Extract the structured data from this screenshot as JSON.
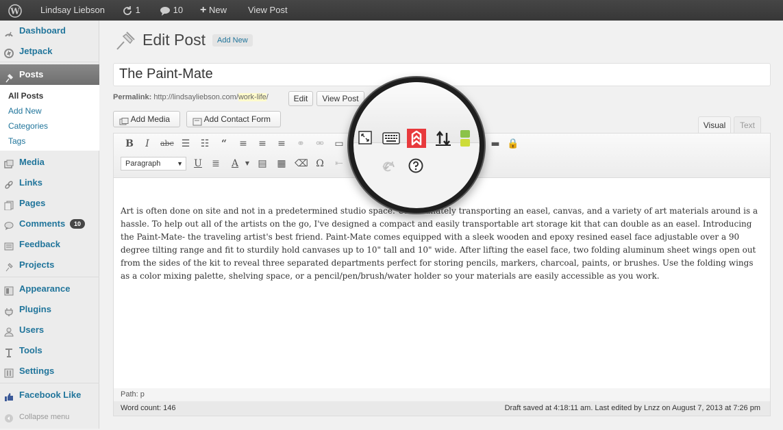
{
  "admin_bar": {
    "user": "Lindsay Liebson",
    "updates_count": "1",
    "comments_count": "10",
    "new_label": "New",
    "view_post_label": "View Post"
  },
  "sidebar": {
    "items": [
      {
        "label": "Dashboard",
        "icon": "dashboard-icon"
      },
      {
        "label": "Jetpack",
        "icon": "jetpack-icon"
      },
      {
        "label": "Posts",
        "icon": "pin-icon"
      },
      {
        "label": "Media",
        "icon": "media-icon"
      },
      {
        "label": "Links",
        "icon": "link-icon"
      },
      {
        "label": "Pages",
        "icon": "pages-icon"
      },
      {
        "label": "Comments",
        "icon": "comment-icon",
        "badge": "10"
      },
      {
        "label": "Feedback",
        "icon": "feedback-icon"
      },
      {
        "label": "Projects",
        "icon": "projects-icon"
      },
      {
        "label": "Appearance",
        "icon": "appearance-icon"
      },
      {
        "label": "Plugins",
        "icon": "plugin-icon"
      },
      {
        "label": "Users",
        "icon": "users-icon"
      },
      {
        "label": "Tools",
        "icon": "tools-icon"
      },
      {
        "label": "Settings",
        "icon": "settings-icon"
      },
      {
        "label": "Facebook Like",
        "icon": "thumbs-up-icon"
      }
    ],
    "posts_submenu": [
      "All Posts",
      "Add New",
      "Categories",
      "Tags"
    ],
    "collapse_label": "Collapse menu"
  },
  "page": {
    "heading": "Edit Post",
    "add_new_label": "Add New"
  },
  "post": {
    "title": "The Paint-Mate",
    "permalink_label": "Permalink:",
    "permalink_base": "http://lindsayliebson.com/",
    "permalink_slug": "work-life",
    "permalink_trailing": "/",
    "edit_label": "Edit",
    "view_post_label": "View Post"
  },
  "media_buttons": {
    "add_media": "Add Media",
    "add_contact_form": "Add Contact Form"
  },
  "editor_tabs": {
    "visual": "Visual",
    "text": "Text"
  },
  "toolbar": {
    "format_select_value": "Paragraph"
  },
  "content": {
    "body": "Art is often done on site and not in a predetermined studio space. Unfortunately transporting an easel, canvas, and a variety of art materials around is a hassle. To help out all of the artists on the go, I've designed a compact and easily transportable art storage kit that can double as an easel. Introducing the Paint-Mate- the traveling artist's best friend. Paint-Mate comes equipped with a sleek wooden and epoxy resined easel face adjustable over a 90 degree tilting range and fit to sturdily hold canvases up to 10\" tall and 10\" wide. After lifting the easel face, two folding aluminum sheet wings open out from the sides of the kit to reveal three separated departments perfect for storing pencils, markers, charcoal, paints, or brushes. Use the folding wings as a color mixing palette, shelving space, or a pencil/pen/brush/water holder so your materials are easily accessible as you work."
  },
  "status": {
    "path": "Path: p",
    "word_count": "Word count: 146",
    "draft_saved": "Draft saved at 4:18:11 am. Last edited by Lnzz on August 7, 2013 at 7:26 pm"
  },
  "colors": {
    "link": "#21759b",
    "admin_bar": "#3f3f3f",
    "highlight_icon": "#e8393c"
  }
}
